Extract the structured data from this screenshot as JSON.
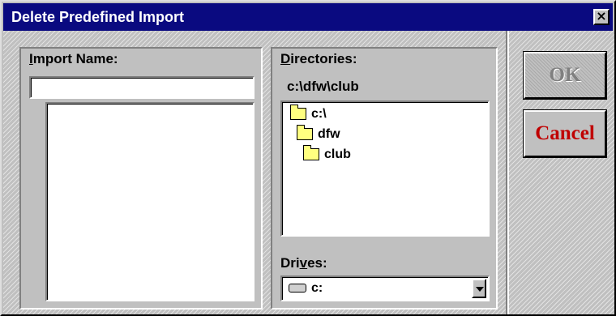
{
  "window": {
    "title": "Delete Predefined Import",
    "close_glyph": "×"
  },
  "import_name": {
    "label_prefix": "",
    "label_access": "I",
    "label_rest": "mport Name:",
    "value": "",
    "list_items": []
  },
  "directories": {
    "label_access": "D",
    "label_rest": "irectories:",
    "current_path": "c:\\dfw\\club",
    "items": [
      {
        "name": "c:\\",
        "icon": "open-folder-icon"
      },
      {
        "name": "dfw",
        "icon": "open-folder-icon"
      },
      {
        "name": "club",
        "icon": "open-folder-icon"
      }
    ]
  },
  "drives": {
    "label_prefix": "Dri",
    "label_access": "v",
    "label_rest": "es:",
    "selected": "c:",
    "icon": "drive-icon"
  },
  "buttons": {
    "ok": "OK",
    "cancel": "Cancel"
  },
  "colors": {
    "titlebar": "#0a0a80",
    "cancel_text": "#c00000",
    "ok_disabled_text": "#808080"
  }
}
